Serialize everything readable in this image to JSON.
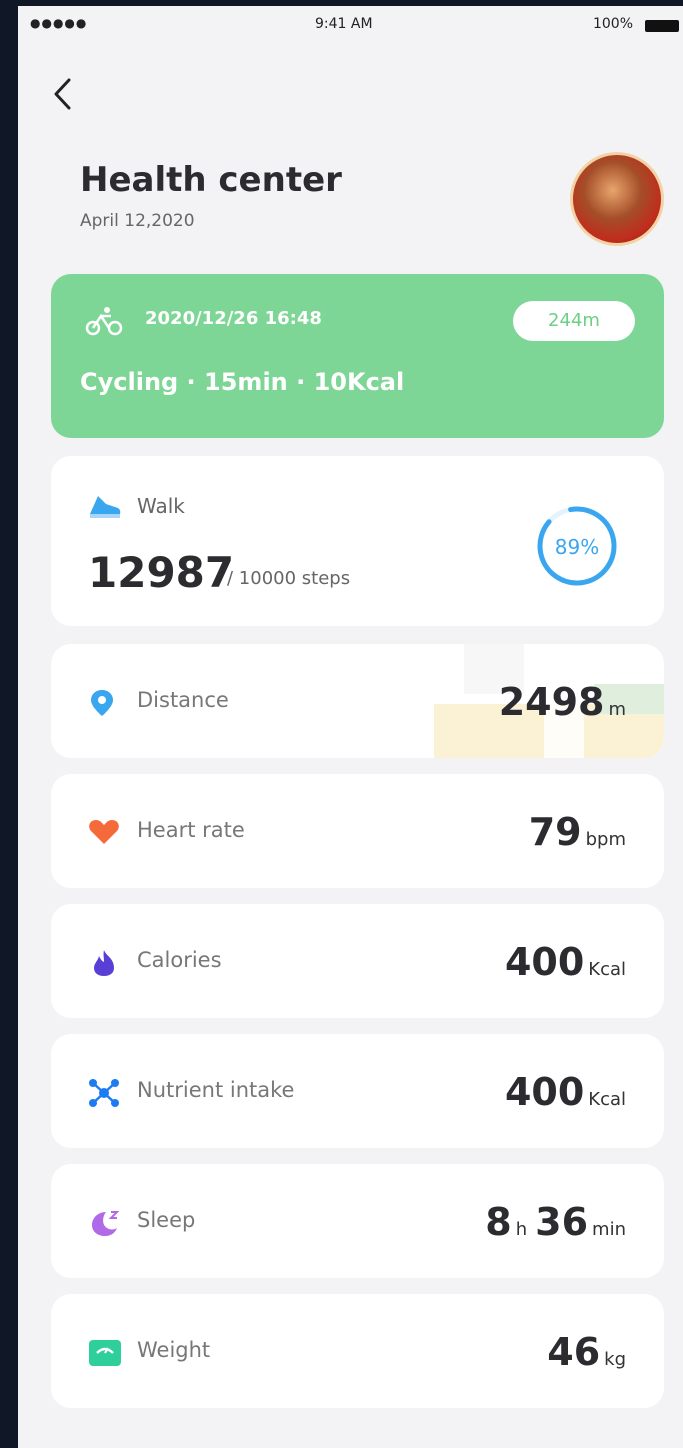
{
  "status": {
    "signal": "●●●●● ",
    "time": "9:41 AM",
    "battery": "100%"
  },
  "header": {
    "title": "Health center",
    "date": "April 12,2020"
  },
  "activity": {
    "timestamp": "2020/12/26 16:48",
    "distance_badge": "244m",
    "summary": "Cycling · 15min · 10Kcal"
  },
  "walk": {
    "label": "Walk",
    "steps": "12987",
    "goal": "/ 10000 steps",
    "percent_label": "89%",
    "percent": 0.89
  },
  "metrics": [
    {
      "label": "Distance",
      "value": "2498",
      "unit": "m"
    },
    {
      "label": "Heart rate",
      "value": "79",
      "unit": "bpm"
    },
    {
      "label": "Calories",
      "value": "400",
      "unit": "Kcal"
    },
    {
      "label": "Nutrient intake",
      "value": "400",
      "unit": "Kcal"
    },
    {
      "label": "Sleep",
      "value": "8",
      "unit": "h",
      "value2": "36",
      "unit2": "min"
    },
    {
      "label": "Weight",
      "value": "46",
      "unit": "kg"
    }
  ],
  "colors": {
    "accent_green": "#7ed696",
    "ring_blue": "#3aa6f0",
    "heart": "#f56a3b",
    "calories": "#5a3fd6",
    "nutrient": "#1e7cf2",
    "sleep": "#b06ae8",
    "weight": "#2ecf9a",
    "distance_pin": "#3aa6f0"
  },
  "icons": {
    "back": "chevron-left-icon",
    "cycle": "bicycle-icon",
    "walk": "shoe-icon",
    "distance": "location-pin-icon",
    "heart": "heart-icon",
    "calories": "flame-icon",
    "nutrient": "molecule-icon",
    "sleep": "moon-icon",
    "weight": "scale-icon"
  }
}
